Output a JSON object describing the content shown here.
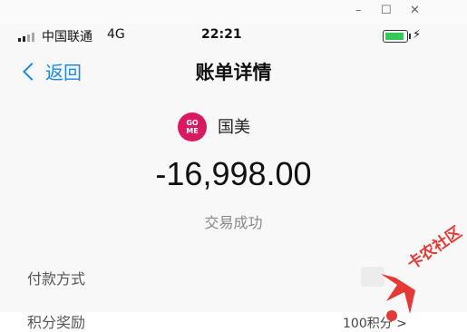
{
  "window": {
    "controls": {
      "minimize": "–",
      "maximize": "☐",
      "close": "✕"
    }
  },
  "status_bar": {
    "carrier": "中国联通",
    "network": "4G",
    "time": "22:21",
    "bolt": "⚡"
  },
  "nav": {
    "back_label": "返回",
    "title": "账单详情"
  },
  "merchant": {
    "logo_text": "GOME",
    "name": "国美"
  },
  "transaction": {
    "amount": "-16,998.00",
    "status": "交易成功"
  },
  "details": {
    "payment_method_label": "付款方式",
    "partial_label": "积分奖励",
    "partial_value": "100积分 >"
  },
  "watermark": {
    "text": "卡农社区"
  },
  "colors": {
    "accent": "#1e88e5",
    "logo": "#d81b60",
    "battery": "#35c759",
    "watermark": "#e53935"
  }
}
